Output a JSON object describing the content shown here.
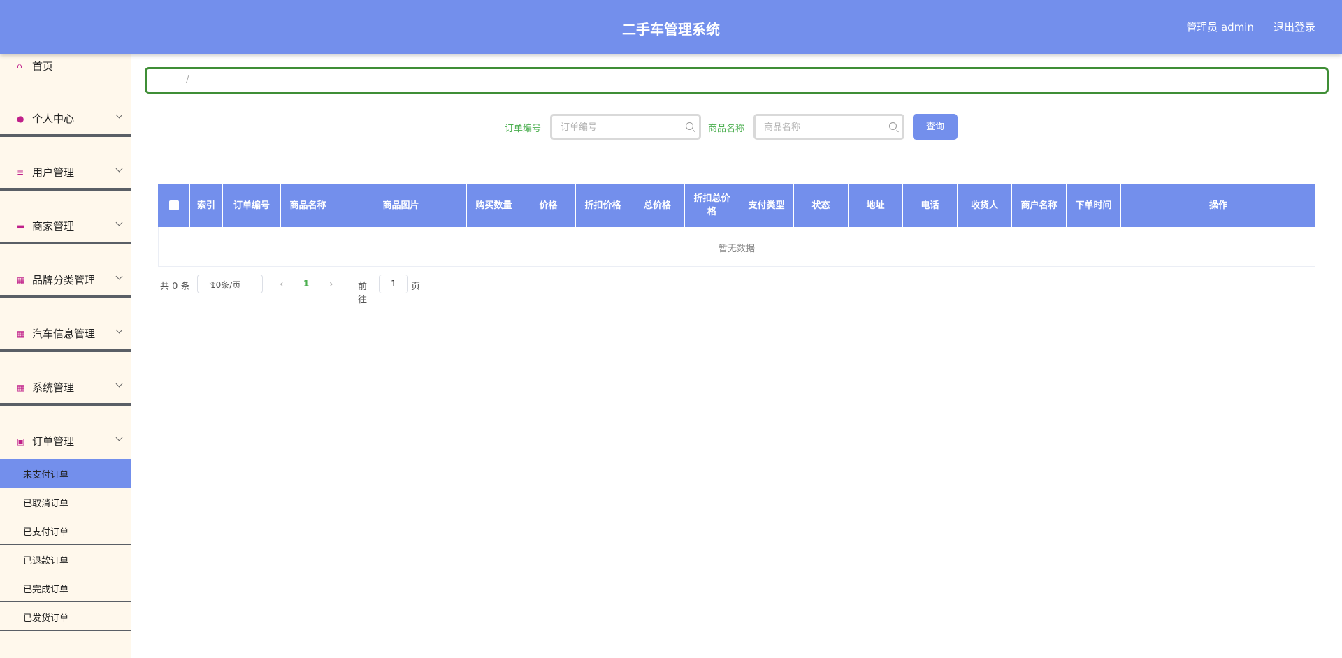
{
  "header": {
    "title": "二手车管理系统",
    "user": "管理员 admin",
    "logout": "退出登录"
  },
  "sidebar": {
    "home": "首页",
    "items": [
      {
        "label": "个人中心",
        "icon": "person-icon"
      },
      {
        "label": "用户管理",
        "icon": "sliders-icon"
      },
      {
        "label": "商家管理",
        "icon": "monitor-icon"
      },
      {
        "label": "品牌分类管理",
        "icon": "grid-icon"
      },
      {
        "label": "汽车信息管理",
        "icon": "grid-icon"
      },
      {
        "label": "系统管理",
        "icon": "grid-icon"
      },
      {
        "label": "订单管理",
        "icon": "wallet-icon"
      }
    ],
    "submenu": [
      "未支付订单",
      "已取消订单",
      "已支付订单",
      "已退款订单",
      "已完成订单",
      "已发货订单"
    ],
    "active_sub": "未支付订单"
  },
  "breadcrumb": {
    "separator": "/"
  },
  "search": {
    "order_no_label": "订单编号",
    "order_no_placeholder": "订单编号",
    "product_label": "商品名称",
    "product_placeholder": "商品名称",
    "query": "查询"
  },
  "table": {
    "columns": [
      "索引",
      "订单编号",
      "商品名称",
      "商品图片",
      "购买数量",
      "价格",
      "折扣价格",
      "总价格",
      "折扣总价格",
      "支付类型",
      "状态",
      "地址",
      "电话",
      "收货人",
      "商户名称",
      "下单时间",
      "操作"
    ],
    "empty": "暂无数据"
  },
  "pager": {
    "total": "共 0 条",
    "page_size": "10条/页",
    "current_page": "1",
    "goto": "前往",
    "goto_value": "1",
    "page_suffix": "页"
  },
  "colors": {
    "header": "#738fec",
    "sidebar": "#fff8ec",
    "accent": "#738fec",
    "green": "#4caf50"
  }
}
